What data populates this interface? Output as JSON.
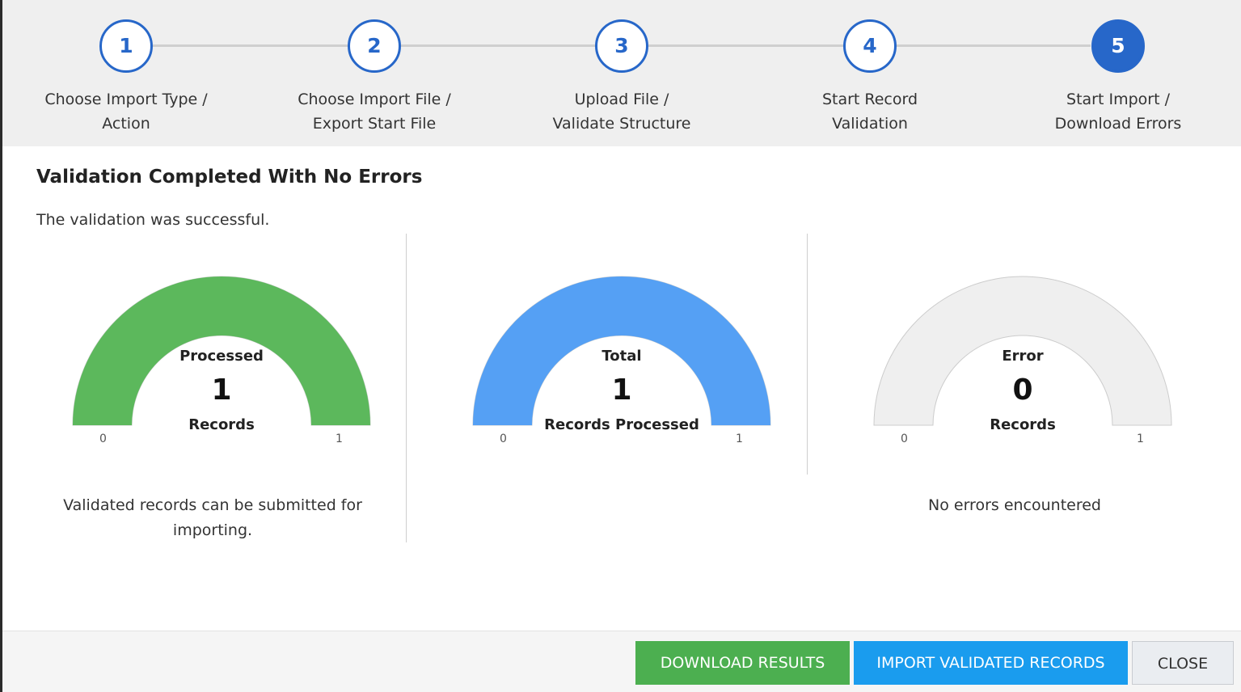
{
  "stepper": {
    "steps": [
      {
        "number": "1",
        "label_line1": "Choose Import Type /",
        "label_line2": "Action"
      },
      {
        "number": "2",
        "label_line1": "Choose Import File /",
        "label_line2": "Export Start File"
      },
      {
        "number": "3",
        "label_line1": "Upload File /",
        "label_line2": "Validate Structure"
      },
      {
        "number": "4",
        "label_line1": "Start Record",
        "label_line2": "Validation"
      },
      {
        "number": "5",
        "label_line1": "Start Import /",
        "label_line2": "Download Errors"
      }
    ],
    "active_step": 5,
    "accent_color": "#2767c9"
  },
  "main": {
    "title": "Validation Completed With No Errors",
    "subtitle": "The validation was successful."
  },
  "gauges": [
    {
      "label": "Processed",
      "value": "1",
      "unit": "Records",
      "min": "0",
      "max": "1",
      "fill_fraction": 1,
      "color": "#5cb85c",
      "caption_line1": "Validated records can be submitted for",
      "caption_line2": "importing."
    },
    {
      "label": "Total",
      "value": "1",
      "unit": "Records Processed",
      "min": "0",
      "max": "1",
      "fill_fraction": 1,
      "color": "#55a0f4",
      "caption_line1": "",
      "caption_line2": ""
    },
    {
      "label": "Error",
      "value": "0",
      "unit": "Records",
      "min": "0",
      "max": "1",
      "fill_fraction": 0,
      "color": "#efefef",
      "caption_line1": "No errors encountered",
      "caption_line2": ""
    }
  ],
  "footer": {
    "download_label": "DOWNLOAD RESULTS",
    "import_label": "IMPORT VALIDATED RECORDS",
    "close_label": "CLOSE"
  }
}
